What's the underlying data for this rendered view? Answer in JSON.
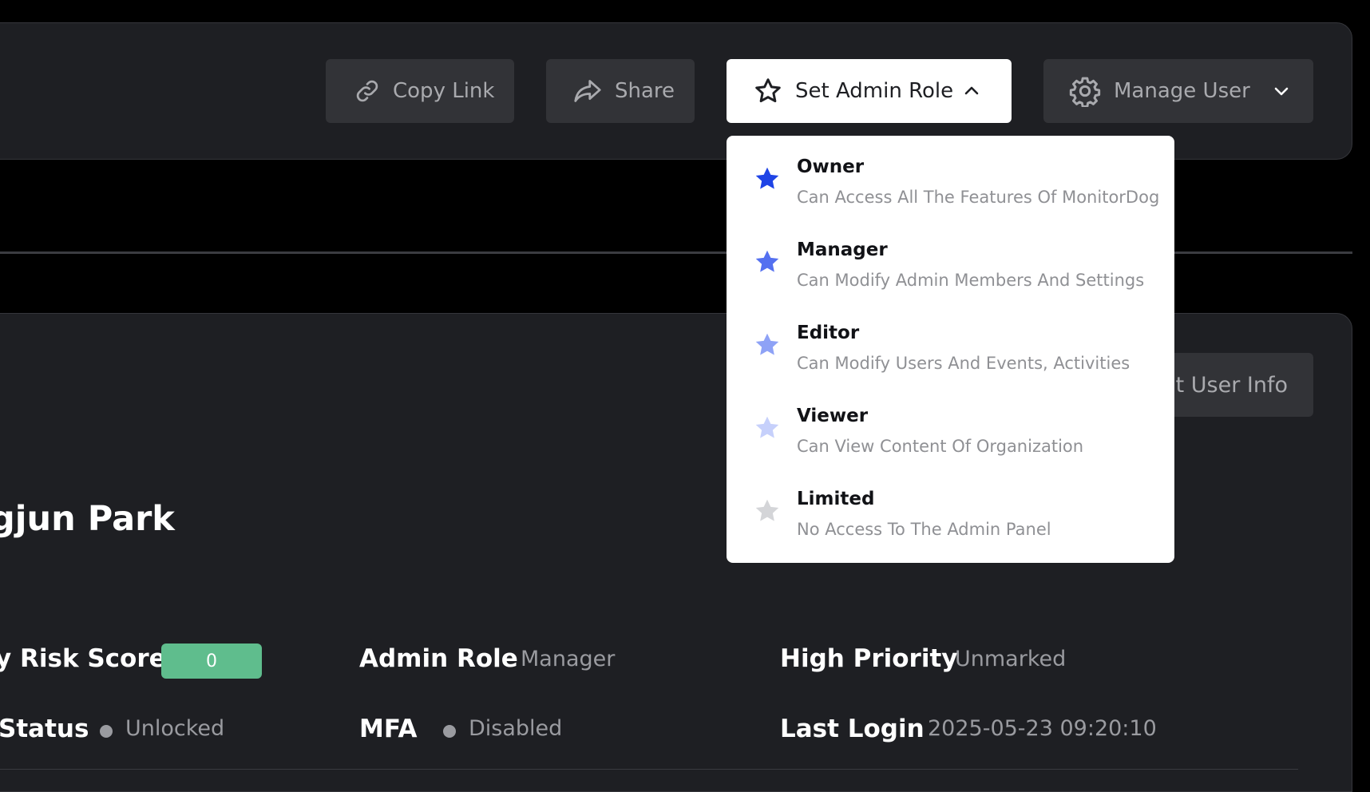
{
  "toolbar": {
    "copy_link_label": "Copy Link",
    "share_label": "Share",
    "set_admin_role_label": "Set Admin Role",
    "manage_user_label": "Manage User"
  },
  "roles": [
    {
      "title": "Owner",
      "description": "Can Access All The Features Of MonitorDog",
      "star_color": "#1f44e6"
    },
    {
      "title": "Manager",
      "description": "Can Modify Admin Members And Settings",
      "star_color": "#5470f0"
    },
    {
      "title": "Editor",
      "description": "Can Modify Users And Events, Activities",
      "star_color": "#8ea2f6"
    },
    {
      "title": "Viewer",
      "description": "Can View Content Of Organization",
      "star_color": "#c6d0fb"
    },
    {
      "title": "Limited",
      "description": "No Access To The Admin Panel",
      "star_color": "#d4d5d8"
    }
  ],
  "profile": {
    "edit_button_label": "dit User Info",
    "name": "gjun Park",
    "risk_score_label": "y Risk Score",
    "risk_score_value": "0",
    "risk_score_color": "#5fbd8d",
    "status_label": "Status",
    "status_value": "Unlocked",
    "admin_role_label": "Admin Role",
    "admin_role_value": "Manager",
    "mfa_label": "MFA",
    "mfa_value": "Disabled",
    "high_priority_label": "High Priority",
    "high_priority_value": "Unmarked",
    "last_login_label": "Last Login",
    "last_login_value": "2025-05-23 09:20:10"
  }
}
